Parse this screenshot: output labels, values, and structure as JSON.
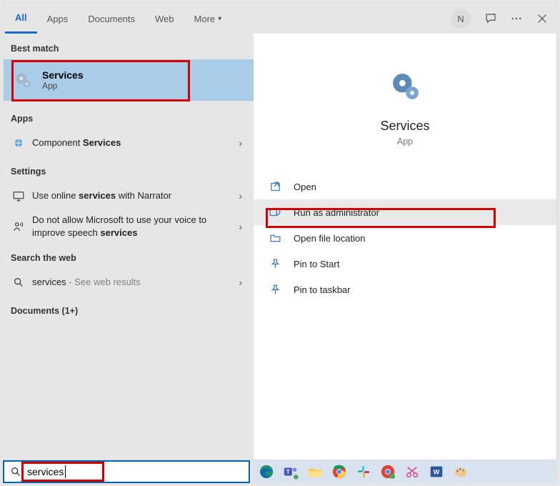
{
  "tabs": {
    "all": "All",
    "apps": "Apps",
    "documents": "Documents",
    "web": "Web",
    "more": "More"
  },
  "avatar_initial": "N",
  "sections": {
    "best_match": "Best match",
    "apps": "Apps",
    "settings": "Settings",
    "search_web": "Search the web",
    "documents": "Documents (1+)"
  },
  "best": {
    "title": "Services",
    "subtitle": "App"
  },
  "left_items": {
    "component_services_pre": "Component ",
    "component_services_bold": "Services",
    "narrator_pre": "Use online ",
    "narrator_bold": "services",
    "narrator_post": " with Narrator",
    "speech_pre": "Do not allow Microsoft to use your voice to improve speech ",
    "speech_bold": "services",
    "web_query": "services",
    "web_suffix": " - See web results"
  },
  "preview": {
    "title": "Services",
    "subtitle": "App"
  },
  "actions": {
    "open": "Open",
    "run_admin": "Run as administrator",
    "open_loc": "Open file location",
    "pin_start": "Pin to Start",
    "pin_taskbar": "Pin to taskbar"
  },
  "search_value": "services"
}
